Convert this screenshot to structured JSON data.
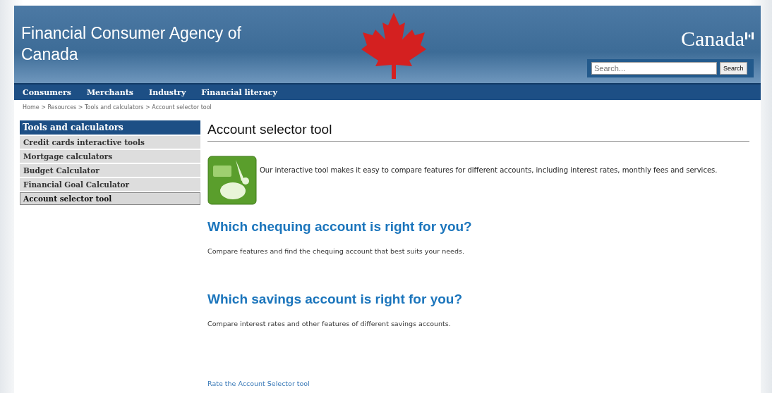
{
  "header": {
    "agency": "Financial Consumer Agency of Canada",
    "wordmark": "Canada",
    "search": {
      "placeholder": "Search...",
      "button": "Search"
    }
  },
  "nav": [
    "Consumers",
    "Merchants",
    "Industry",
    "Financial literacy"
  ],
  "breadcrumb": "Home > Resources > Tools and calculators > Account selector tool",
  "sidebar": {
    "title": "Tools and calculators",
    "items": [
      {
        "label": "Credit cards interactive tools",
        "selected": false
      },
      {
        "label": "Mortgage calculators",
        "selected": false
      },
      {
        "label": "Budget Calculator",
        "selected": false
      },
      {
        "label": "Financial Goal Calculator",
        "selected": false
      },
      {
        "label": "Account selector tool",
        "selected": true
      }
    ]
  },
  "main": {
    "title": "Account selector tool",
    "intro": "Our interactive tool makes it easy to compare features for different accounts, including interest rates, monthly fees and services.",
    "sections": [
      {
        "heading": "Which chequing account is right for you?",
        "text": "Compare features and find the chequing account that best suits your needs."
      },
      {
        "heading": "Which savings account is right for you?",
        "text": "Compare interest rates and other features of different savings accounts."
      }
    ],
    "rate_link": "Rate the Account Selector tool"
  }
}
